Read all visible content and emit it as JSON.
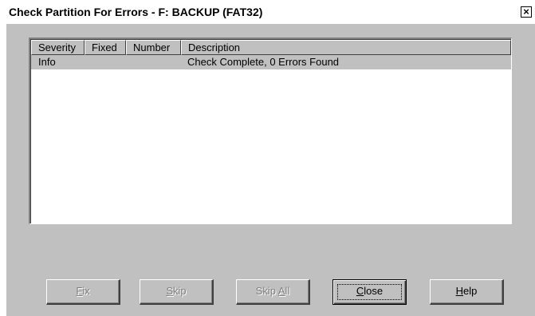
{
  "window": {
    "title": "Check Partition For Errors - F: BACKUP (FAT32)",
    "close_glyph": "×"
  },
  "list": {
    "columns": [
      "Severity",
      "Fixed",
      "Number",
      "Description"
    ],
    "rows": [
      {
        "severity": "Info",
        "fixed": "",
        "number": "",
        "description": "Check Complete, 0 Errors Found"
      }
    ]
  },
  "buttons": {
    "fix": {
      "label_u": "F",
      "label_rest": "ix",
      "enabled": false
    },
    "skip": {
      "label_u": "S",
      "label_rest": "kip",
      "enabled": false
    },
    "skip_all": {
      "label_pre": "Skip ",
      "label_u": "A",
      "label_rest": "ll",
      "enabled": false
    },
    "close": {
      "label_u": "C",
      "label_rest": "lose",
      "enabled": true,
      "default": true
    },
    "help": {
      "label_u": "H",
      "label_rest": "elp",
      "enabled": true
    }
  }
}
